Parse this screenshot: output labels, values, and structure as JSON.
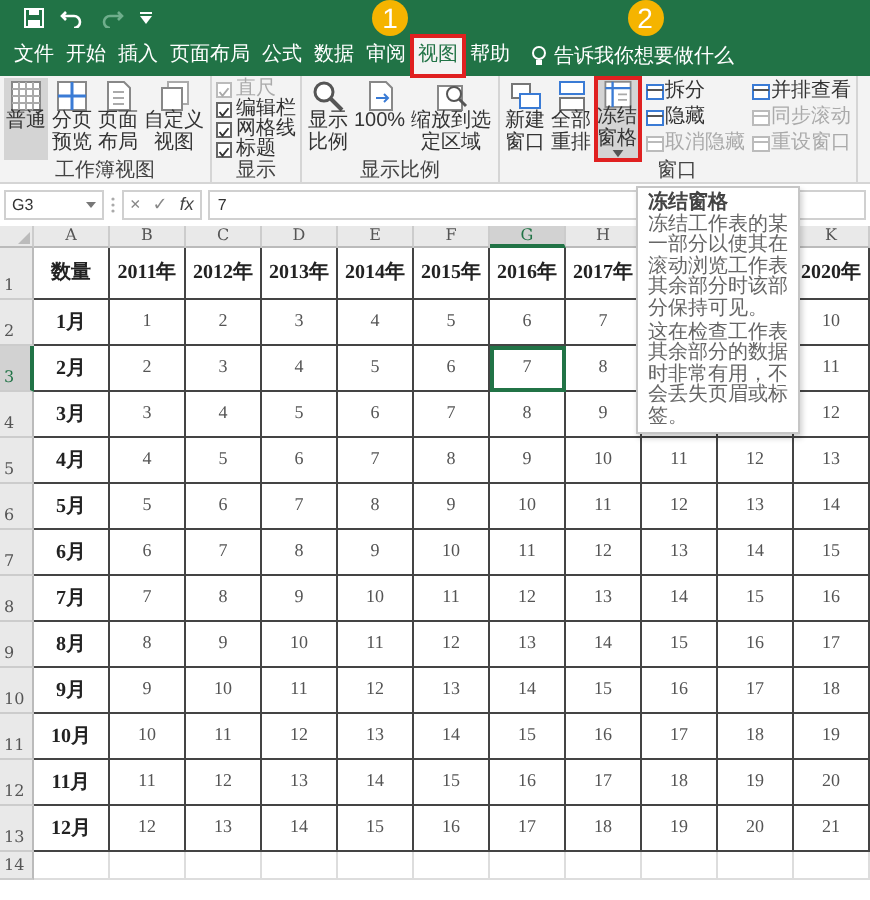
{
  "tabs": [
    {
      "label": "文件",
      "selected": false
    },
    {
      "label": "开始",
      "selected": false
    },
    {
      "label": "插入",
      "selected": false
    },
    {
      "label": "页面布局",
      "selected": false
    },
    {
      "label": "公式",
      "selected": false
    },
    {
      "label": "数据",
      "selected": false
    },
    {
      "label": "审阅",
      "selected": false
    },
    {
      "label": "视图",
      "selected": true,
      "callout": "1"
    },
    {
      "label": "帮助",
      "selected": false
    }
  ],
  "tell_me": "告诉我你想要做什么",
  "ribbon_groups": [
    {
      "label": "工作簿视图",
      "items": [
        {
          "kind": "large",
          "label": "普通",
          "selected": true
        },
        {
          "kind": "large",
          "label": "分页预览",
          "selected": false
        },
        {
          "kind": "large",
          "label": "页面布局",
          "selected": false
        },
        {
          "kind": "large",
          "label": "自定义视图",
          "selected": false
        }
      ]
    },
    {
      "label": "显示",
      "items": [
        {
          "kind": "checkbox",
          "label": "直尺",
          "checked": true,
          "disabled": true
        },
        {
          "kind": "checkbox",
          "label": "编辑栏",
          "checked": true,
          "disabled": false
        },
        {
          "kind": "checkbox",
          "label": "网格线",
          "checked": true,
          "disabled": false
        },
        {
          "kind": "checkbox",
          "label": "标题",
          "checked": true,
          "disabled": false
        }
      ]
    },
    {
      "label": "显示比例",
      "items": [
        {
          "kind": "large",
          "label": "显示比例"
        },
        {
          "kind": "large",
          "label": "100%"
        },
        {
          "kind": "large",
          "label": "缩放到选定区域"
        }
      ]
    },
    {
      "label": "窗口",
      "items": [
        {
          "kind": "large",
          "label": "新建窗口",
          "selected": false
        },
        {
          "kind": "large",
          "label": "全部重排",
          "selected": false
        },
        {
          "kind": "large",
          "label": "冻结窗格",
          "selected": true,
          "dropdown": true,
          "callout": "2"
        },
        {
          "kind": "small",
          "label": "拆分",
          "disabled": false
        },
        {
          "kind": "small",
          "label": "隐藏",
          "disabled": false
        },
        {
          "kind": "small",
          "label": "取消隐藏",
          "disabled": true
        },
        {
          "kind": "small",
          "label": "并排查看",
          "disabled": false
        },
        {
          "kind": "small",
          "label": "同步滚动",
          "disabled": true
        },
        {
          "kind": "small",
          "label": "重设窗口",
          "disabled": true
        }
      ]
    }
  ],
  "formula_bar": {
    "name_box": "G3",
    "cancel": "×",
    "enter": "✓",
    "function": "fx",
    "value": "7"
  },
  "sheet": {
    "columns": [
      {
        "label": "A",
        "selected": false
      },
      {
        "label": "B",
        "selected": false
      },
      {
        "label": "C",
        "selected": false
      },
      {
        "label": "D",
        "selected": false
      },
      {
        "label": "E",
        "selected": false
      },
      {
        "label": "F",
        "selected": false
      },
      {
        "label": "G",
        "selected": true
      },
      {
        "label": "H",
        "selected": false
      },
      {},
      {},
      {
        "label": "K",
        "selected": false
      }
    ],
    "rows": [
      {
        "number": "1",
        "selected": false,
        "cells": [
          "数量",
          "2011年",
          "2012年",
          "2013年",
          "2014年",
          "2015年",
          "2016年",
          "2017年",
          null,
          null,
          "2020年"
        ]
      },
      {
        "number": "2",
        "selected": false,
        "cells": [
          "1月",
          "1",
          "2",
          "3",
          "4",
          "5",
          "6",
          "7",
          null,
          null,
          "10"
        ]
      },
      {
        "number": "3",
        "selected": true,
        "cells": [
          "2月",
          "2",
          "3",
          "4",
          "5",
          "6",
          "7",
          "8",
          null,
          null,
          "11"
        ]
      },
      {
        "number": "4",
        "selected": false,
        "cells": [
          "3月",
          "3",
          "4",
          "5",
          "6",
          "7",
          "8",
          "9",
          null,
          null,
          "12"
        ]
      },
      {
        "number": "5",
        "selected": false,
        "cells": [
          "4月",
          "4",
          "5",
          "6",
          "7",
          "8",
          "9",
          "10",
          "11",
          "12",
          "13"
        ]
      },
      {
        "number": "6",
        "selected": false,
        "cells": [
          "5月",
          "5",
          "6",
          "7",
          "8",
          "9",
          "10",
          "11",
          "12",
          "13",
          "14"
        ]
      },
      {
        "number": "7",
        "selected": false,
        "cells": [
          "6月",
          "6",
          "7",
          "8",
          "9",
          "10",
          "11",
          "12",
          "13",
          "14",
          "15"
        ]
      },
      {
        "number": "8",
        "selected": false,
        "cells": [
          "7月",
          "7",
          "8",
          "9",
          "10",
          "11",
          "12",
          "13",
          "14",
          "15",
          "16"
        ]
      },
      {
        "number": "9",
        "selected": false,
        "cells": [
          "8月",
          "8",
          "9",
          "10",
          "11",
          "12",
          "13",
          "14",
          "15",
          "16",
          "17"
        ]
      },
      {
        "number": "10",
        "selected": false,
        "cells": [
          "9月",
          "9",
          "10",
          "11",
          "12",
          "13",
          "14",
          "15",
          "16",
          "17",
          "18"
        ]
      },
      {
        "number": "11",
        "selected": false,
        "cells": [
          "10月",
          "10",
          "11",
          "12",
          "13",
          "14",
          "15",
          "16",
          "17",
          "18",
          "19"
        ]
      },
      {
        "number": "12",
        "selected": false,
        "cells": [
          "11月",
          "11",
          "12",
          "13",
          "14",
          "15",
          "16",
          "17",
          "18",
          "19",
          "20"
        ]
      },
      {
        "number": "13",
        "selected": false,
        "cells": [
          "12月",
          "12",
          "13",
          "14",
          "15",
          "16",
          "17",
          "18",
          "19",
          "20",
          "21"
        ]
      },
      {
        "number": "14",
        "selected": false,
        "cells": []
      }
    ]
  },
  "tooltip": {
    "title": "冻结窗格",
    "paragraphs": [
      "冻结工作表的某一部分以使其在滚动浏览工作表其余部分时该部分保持可见。",
      "这在检查工作表其余部分的数据时非常有用，不会丢失页眉或标签。"
    ]
  }
}
